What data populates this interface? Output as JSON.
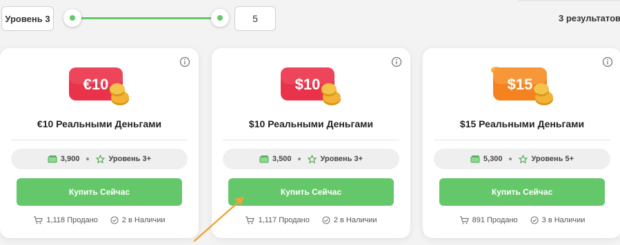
{
  "filters": {
    "level_label": "Уровень 3",
    "level_value": "5",
    "results_text": "3 результатов"
  },
  "colors": {
    "accent_green": "#64c86a",
    "badge_red": "#e8334b",
    "badge_orange": "#f5821f",
    "coin_gold": "#f2b233"
  },
  "cards": [
    {
      "badge_text": "$10",
      "title": "$10 Реальными Деньгами",
      "price": "3,500",
      "level": "Уровень 3+",
      "buy_label": "Купить Сейчас",
      "sold": "1,117 Продано",
      "stock": "2 в Наличии"
    },
    {
      "badge_text": "$15",
      "title": "$15 Реальными Деньгами",
      "price": "5,300",
      "level": "Уровень 5+",
      "buy_label": "Купить Сейчас",
      "sold": "891 Продано",
      "stock": "3 в Наличии"
    },
    {
      "badge_text": "€10",
      "title": "€10 Реальными Деньгами",
      "price": "3,900",
      "level": "Уровень 3+",
      "buy_label": "Купить Сейчас",
      "sold": "1,118 Продано",
      "stock": "2 в Наличии"
    }
  ]
}
